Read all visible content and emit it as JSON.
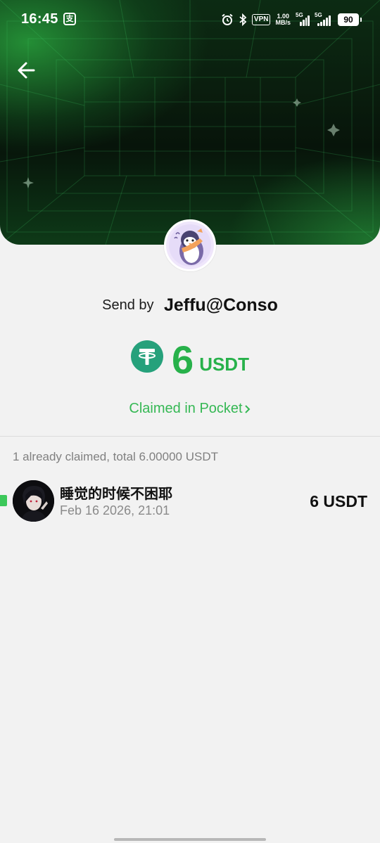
{
  "status_bar": {
    "time": "16:45",
    "app_icon_glyph": "支",
    "vpn": "VPN",
    "net_speed_value": "1.00",
    "net_speed_unit": "MB/s",
    "sim1_label": "5G",
    "sim2_label": "5G",
    "battery": "90"
  },
  "header": {
    "back_icon": "arrow-left-icon"
  },
  "sender": {
    "label": "Send by",
    "name": "Jeffu@Conso"
  },
  "amount": {
    "value": "6",
    "unit": "USDT",
    "token_icon": "tether-icon"
  },
  "claimed_link": "Claimed in Pocket",
  "summary": "1 already claimed, total 6.00000 USDT",
  "claims": [
    {
      "name": "睡觉的时候不困耶",
      "time": "Feb 16 2026, 21:01",
      "amount": "6 USDT"
    }
  ],
  "colors": {
    "accent_green": "#27b14a",
    "background": "#f2f2f2",
    "banner_dark": "#07140a"
  }
}
